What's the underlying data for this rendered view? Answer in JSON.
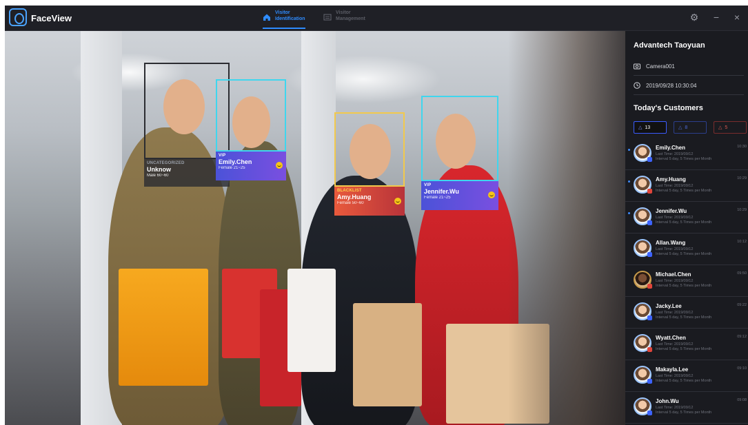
{
  "app": {
    "title": "FaceView"
  },
  "nav": {
    "tabs": [
      {
        "line1": "Visitor",
        "line2": "Identification",
        "active": true,
        "icon": "home-icon"
      },
      {
        "line1": "Visitor",
        "line2": "Management",
        "active": false,
        "icon": "list-icon"
      }
    ]
  },
  "window_controls": {
    "settings": "⚙",
    "minimize": "−",
    "close": "×"
  },
  "detections": [
    {
      "tag": "UNCATEGORIZED",
      "name": "Unknow",
      "sub": "Male  60~60",
      "color": "#2b2c31",
      "card_color": "#2b2c31",
      "smiling": false
    },
    {
      "tag": "VIP",
      "name": "Emily.Chen",
      "sub": "Female  21~25",
      "color": "#3fd6ee",
      "card_color": "#5b4fe0",
      "smiling": true
    },
    {
      "tag": "BLACKLIST",
      "name": "Amy.Huang",
      "sub": "Female  50~60",
      "color": "#f2c94c",
      "card_color": "#e04a3f",
      "smiling": true
    },
    {
      "tag": "VIP",
      "name": "Jennifer.Wu",
      "sub": "Female  21~25",
      "color": "#3fd6ee",
      "card_color": "#5b4fe0",
      "smiling": true
    }
  ],
  "sidebar": {
    "site": "Advantech Taoyuan",
    "camera": "Camera001",
    "datetime": "2019/09/28 10:30:04",
    "section_title": "Today's Customers",
    "counts": {
      "all": "13",
      "vip": "8",
      "blacklist": "5"
    },
    "customers": [
      {
        "name": "Emily.Chen",
        "last_time": "Last Time: 2019/09/12",
        "interval": "Interval 5 day,  5 Times per Month",
        "time": "10:30",
        "unread": true,
        "badge": "blue"
      },
      {
        "name": "Amy.Huang",
        "last_time": "Last Time: 2019/09/12",
        "interval": "Interval 5 day,  5 Times per Month",
        "time": "10:29",
        "unread": true,
        "badge": "red"
      },
      {
        "name": "Jennifer.Wu",
        "last_time": "Last Time: 2019/09/12",
        "interval": "Interval 5 day,  5 Times per Month",
        "time": "10:29",
        "unread": true,
        "badge": "blue"
      },
      {
        "name": "Allan.Wang",
        "last_time": "Last Time: 2019/09/12",
        "interval": "Interval 5 day,  5 Times per Month",
        "time": "10:12",
        "unread": false,
        "badge": "blue"
      },
      {
        "name": "Michael.Chen",
        "last_time": "Last Time: 2019/09/12",
        "interval": "Interval 5 day,  5 Times per Month",
        "time": "09:50",
        "unread": false,
        "badge": "red"
      },
      {
        "name": "Jacky.Lee",
        "last_time": "Last Time: 2019/09/12",
        "interval": "Interval 5 day,  5 Times per Month",
        "time": "09:22",
        "unread": false,
        "badge": "blue"
      },
      {
        "name": "Wyatt.Chen",
        "last_time": "Last Time: 2019/09/12",
        "interval": "Interval 5 day,  5 Times per Month",
        "time": "09:12",
        "unread": false,
        "badge": "red"
      },
      {
        "name": "Makayla.Lee",
        "last_time": "Last Time: 2019/09/12",
        "interval": "Interval 5 day,  5 Times per Month",
        "time": "09:10",
        "unread": false,
        "badge": "blue"
      },
      {
        "name": "John.Wu",
        "last_time": "Last Time: 2019/09/12",
        "interval": "Interval 5 day,  5 Times per Month",
        "time": "09:08",
        "unread": false,
        "badge": "blue"
      }
    ]
  }
}
